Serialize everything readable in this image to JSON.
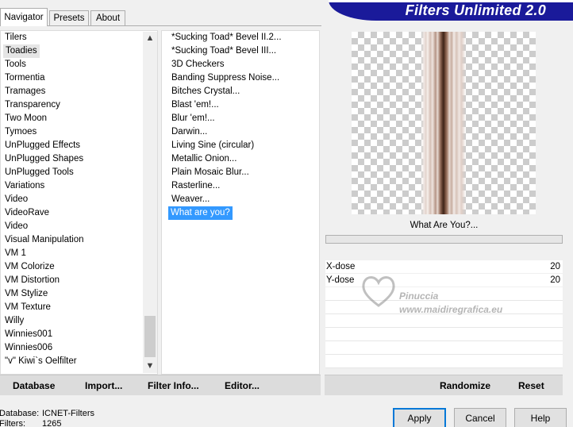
{
  "tabs": [
    "Navigator",
    "Presets",
    "About"
  ],
  "title": "Filters Unlimited 2.0",
  "categories": [
    "Tilers",
    "Toadies",
    "Tools",
    "Tormentia",
    "Tramages",
    "Transparency",
    "Two Moon",
    "Tymoes",
    "UnPlugged Effects",
    "UnPlugged Shapes",
    "UnPlugged Tools",
    "Variations",
    "Video",
    "VideoRave",
    "Video",
    "Visual Manipulation",
    "VM 1",
    "VM Colorize",
    "VM Distortion",
    "VM Stylize",
    "VM Texture",
    "Willy",
    "Winnies001",
    "Winnies006",
    "\"v\" Kiwi`s Oelfilter"
  ],
  "filters": [
    "*Sucking Toad*  Bevel II.2...",
    "*Sucking Toad*  Bevel III...",
    "3D Checkers",
    "Banding Suppress Noise...",
    "Bitches Crystal...",
    "Blast 'em!...",
    "Blur 'em!...",
    "Darwin...",
    "Living Sine (circular)",
    "Metallic Onion...",
    "Plain Mosaic Blur...",
    "Rasterline...",
    "Weaver...",
    "What are you?"
  ],
  "filter_name": "What Are You?...",
  "params": [
    {
      "label": "X-dose",
      "value": "20"
    },
    {
      "label": "Y-dose",
      "value": "20"
    }
  ],
  "watermark": {
    "name": "Pinuccia",
    "url": "www.maidiregrafica.eu"
  },
  "links": {
    "database": "Database",
    "import": "Import...",
    "filter_info": "Filter Info...",
    "editor": "Editor...",
    "randomize": "Randomize",
    "reset": "Reset"
  },
  "buttons": {
    "apply": "Apply",
    "cancel": "Cancel",
    "help": "Help"
  },
  "status": {
    "database_label": "Database:",
    "database_value": "ICNET-Filters",
    "filters_label": "Filters:",
    "filters_value": "1265"
  },
  "scroll": {
    "up": "▲",
    "down": "▼"
  },
  "colors": {
    "banner": "#1a1a9a",
    "selection": "#3399ff",
    "default_button": "#0078d7"
  }
}
